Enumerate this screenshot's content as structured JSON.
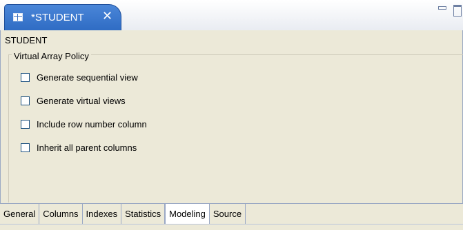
{
  "tab": {
    "title": "*STUDENT",
    "icon": "table-icon",
    "close_icon": "close-icon"
  },
  "header": {
    "label": "STUDENT"
  },
  "group": {
    "legend": "Virtual Array Policy",
    "options": [
      {
        "label": "Generate sequential view",
        "checked": false
      },
      {
        "label": "Generate virtual views",
        "checked": false
      },
      {
        "label": "Include row number column",
        "checked": false
      },
      {
        "label": "Inherit all parent columns",
        "checked": false
      }
    ]
  },
  "bottom_tabs": [
    {
      "label": "General",
      "active": false
    },
    {
      "label": "Columns",
      "active": false
    },
    {
      "label": "Indexes",
      "active": false
    },
    {
      "label": "Statistics",
      "active": false
    },
    {
      "label": "Modeling",
      "active": true
    },
    {
      "label": "Source",
      "active": false
    }
  ],
  "window_controls": {
    "minimize_icon": "minimize-icon",
    "maximize_icon": "maximize-icon"
  }
}
